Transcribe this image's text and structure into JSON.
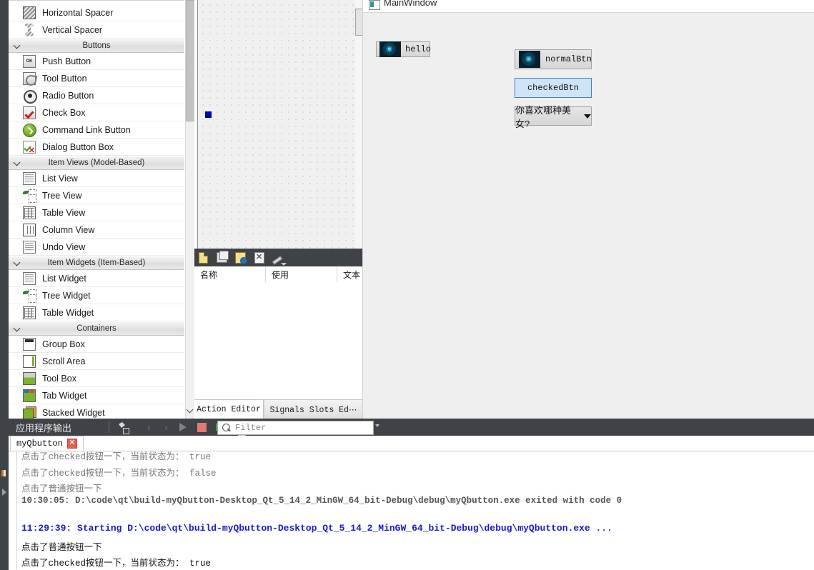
{
  "widget_box": {
    "groups": [
      {
        "label": "",
        "items": [
          {
            "label": "Horizontal Spacer",
            "icon": "horizontal-spacer-icon"
          },
          {
            "label": "Vertical Spacer",
            "icon": "vertical-spacer-icon"
          }
        ]
      },
      {
        "label": "Buttons",
        "items": [
          {
            "label": "Push Button",
            "icon": "push-button-icon"
          },
          {
            "label": "Tool Button",
            "icon": "tool-button-icon"
          },
          {
            "label": "Radio Button",
            "icon": "radio-button-icon"
          },
          {
            "label": "Check Box",
            "icon": "check-box-icon"
          },
          {
            "label": "Command Link Button",
            "icon": "command-link-button-icon"
          },
          {
            "label": "Dialog Button Box",
            "icon": "dialog-button-box-icon"
          }
        ]
      },
      {
        "label": "Item Views (Model-Based)",
        "items": [
          {
            "label": "List View",
            "icon": "list-view-icon"
          },
          {
            "label": "Tree View",
            "icon": "tree-view-icon"
          },
          {
            "label": "Table View",
            "icon": "table-view-icon"
          },
          {
            "label": "Column View",
            "icon": "column-view-icon"
          },
          {
            "label": "Undo View",
            "icon": "undo-view-icon"
          }
        ]
      },
      {
        "label": "Item Widgets (Item-Based)",
        "items": [
          {
            "label": "List Widget",
            "icon": "list-widget-icon"
          },
          {
            "label": "Tree Widget",
            "icon": "tree-widget-icon"
          },
          {
            "label": "Table Widget",
            "icon": "table-widget-icon"
          }
        ]
      },
      {
        "label": "Containers",
        "items": [
          {
            "label": "Group Box",
            "icon": "group-box-icon"
          },
          {
            "label": "Scroll Area",
            "icon": "scroll-area-icon"
          },
          {
            "label": "Tool Box",
            "icon": "tool-box-icon"
          },
          {
            "label": "Tab Widget",
            "icon": "tab-widget-icon"
          },
          {
            "label": "Stacked Widget",
            "icon": "stacked-widget-icon"
          }
        ]
      }
    ]
  },
  "action_editor": {
    "toolbar": [
      {
        "name": "new-action-icon"
      },
      {
        "name": "copy-action-icon"
      },
      {
        "name": "edit-action-icon"
      },
      {
        "name": "delete-action-icon"
      },
      {
        "name": "configure-wrench-icon"
      }
    ],
    "columns": [
      "名称",
      "使用",
      "文本"
    ],
    "tabs": [
      {
        "label": "Action Editor",
        "active": true
      },
      {
        "label": "Signals  Slots Ed⋯",
        "active": false
      }
    ]
  },
  "main_window": {
    "title": "MainWindow",
    "buttons": [
      {
        "name": "hello-button",
        "label": "hello",
        "icon": "photo-icon",
        "checked": false
      },
      {
        "name": "normal-button",
        "label": "normalBtn",
        "icon": "photo-icon",
        "checked": false
      },
      {
        "name": "checked-button",
        "label": "checkedBtn",
        "icon": null,
        "checked": true
      },
      {
        "name": "combo-button",
        "label": "你喜欢哪种美女?",
        "icon": "dropdown-arrow-icon",
        "checked": false
      }
    ]
  },
  "output_pane": {
    "title": "应用程序输出",
    "toolbar": [
      {
        "name": "clear-output-icon"
      },
      {
        "name": "previous-item-icon"
      },
      {
        "name": "next-item-icon"
      },
      {
        "name": "play-icon"
      },
      {
        "name": "stop-icon"
      },
      {
        "name": "rerun-icon"
      },
      {
        "name": "settings-gear-icon"
      }
    ],
    "filter_placeholder": "Filter",
    "filter_value": "",
    "tab": {
      "label": "myQbutton",
      "close": "✕"
    },
    "console_lines": [
      {
        "text": "点击了checked按钮一下，当前状态为：  true",
        "style": "app"
      },
      {
        "text": "点击了checked按钮一下，当前状态为：  false",
        "style": "app"
      },
      {
        "text": "点击了普通按钮一下",
        "style": "app"
      },
      {
        "text": "10:30:05: D:\\code\\qt\\build-myQbutton-Desktop_Qt_5_14_2_MinGW_64_bit-Debug\\debug\\myQbutton.exe exited with code 0",
        "style": "sys"
      },
      {
        "text": "",
        "style": "app"
      },
      {
        "text": "11:29:39: Starting D:\\code\\qt\\build-myQbutton-Desktop_Qt_5_14_2_MinGW_64_bit-Debug\\debug\\myQbutton.exe ...",
        "style": "start"
      },
      {
        "text": "点击了普通按钮一下",
        "style": "app2"
      },
      {
        "text": "点击了checked按钮一下，当前状态为：  true",
        "style": "app2"
      }
    ]
  },
  "colors": {
    "rail": "#3f4246",
    "checked_button_bg": "#cfe4f7",
    "checked_button_border": "#3f7fbf",
    "start_line": "#1a1ad0",
    "stop_icon": "#e07b72"
  }
}
